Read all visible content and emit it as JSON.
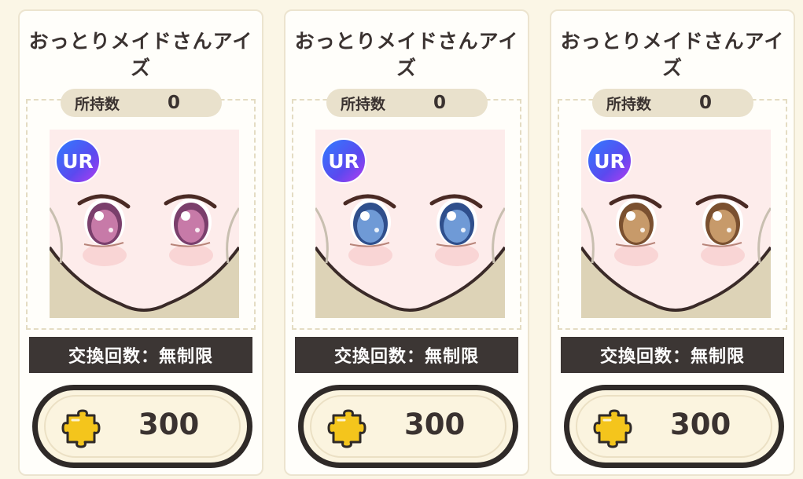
{
  "items": [
    {
      "name": "おっとりメイドさんアイズ",
      "owned_label": "所持数",
      "owned_count": "0",
      "rarity": "UR",
      "exchange_limit": "交換回数：無制限",
      "price": "300",
      "currency_icon": "puzzle-piece-icon",
      "eye_color": "#c77aa8",
      "eye_color_dark": "#7a3f6c"
    },
    {
      "name": "おっとりメイドさんアイズ",
      "owned_label": "所持数",
      "owned_count": "0",
      "rarity": "UR",
      "exchange_limit": "交換回数：無制限",
      "price": "300",
      "currency_icon": "puzzle-piece-icon",
      "eye_color": "#6f9ad6",
      "eye_color_dark": "#2f4f8c"
    },
    {
      "name": "おっとりメイドさんアイズ",
      "owned_label": "所持数",
      "owned_count": "0",
      "rarity": "UR",
      "exchange_limit": "交換回数：無制限",
      "price": "300",
      "currency_icon": "puzzle-piece-icon",
      "eye_color": "#c79a6a",
      "eye_color_dark": "#7a5030"
    }
  ]
}
